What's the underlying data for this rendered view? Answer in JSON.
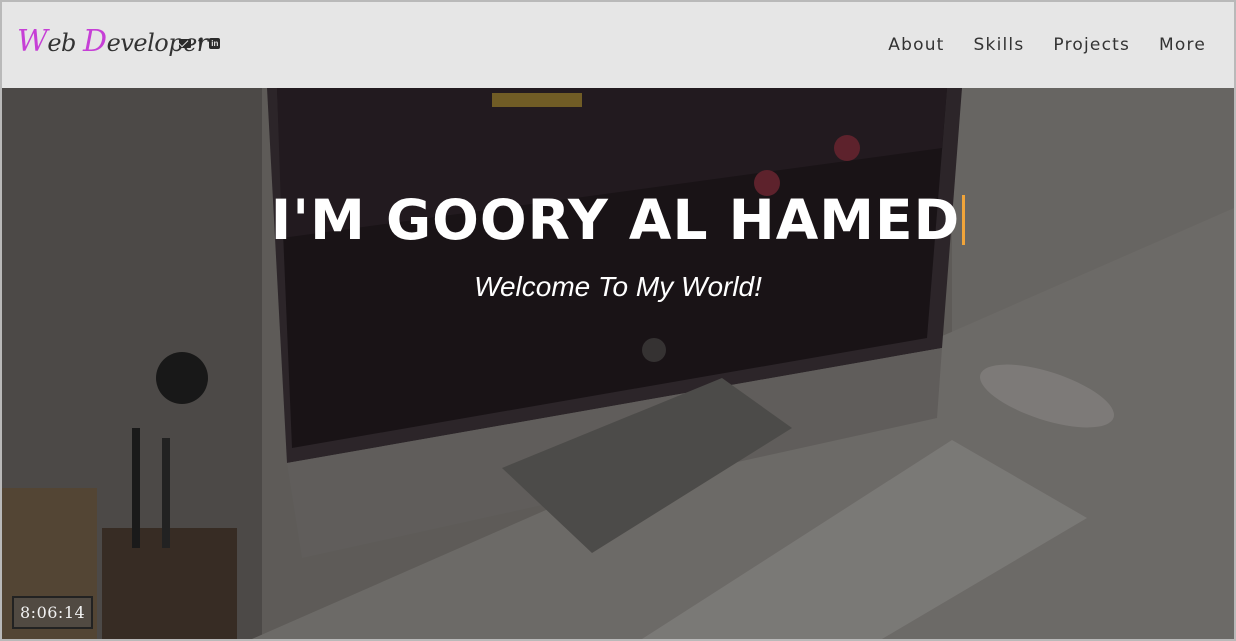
{
  "brand": {
    "first_cap": "W",
    "first_rest": "eb ",
    "second_cap": "D",
    "second_rest": "eveloper"
  },
  "social": {
    "mail_icon": "envelope-icon",
    "fb_letter": "f",
    "fb_icon": "facebook-icon",
    "li_letter": "in",
    "li_icon": "linkedin-icon"
  },
  "nav": [
    {
      "label": "About"
    },
    {
      "label": "Skills"
    },
    {
      "label": "Projects"
    },
    {
      "label": "More"
    }
  ],
  "hero": {
    "headline": "I'M GOORY AL HAMED",
    "tagline": "Welcome To My World!",
    "cursor_color": "#f0a43a"
  },
  "clock": {
    "time": "8:06:14"
  },
  "colors": {
    "brand_accent": "#c63fd6",
    "navbar_bg": "#e6e6e6"
  }
}
